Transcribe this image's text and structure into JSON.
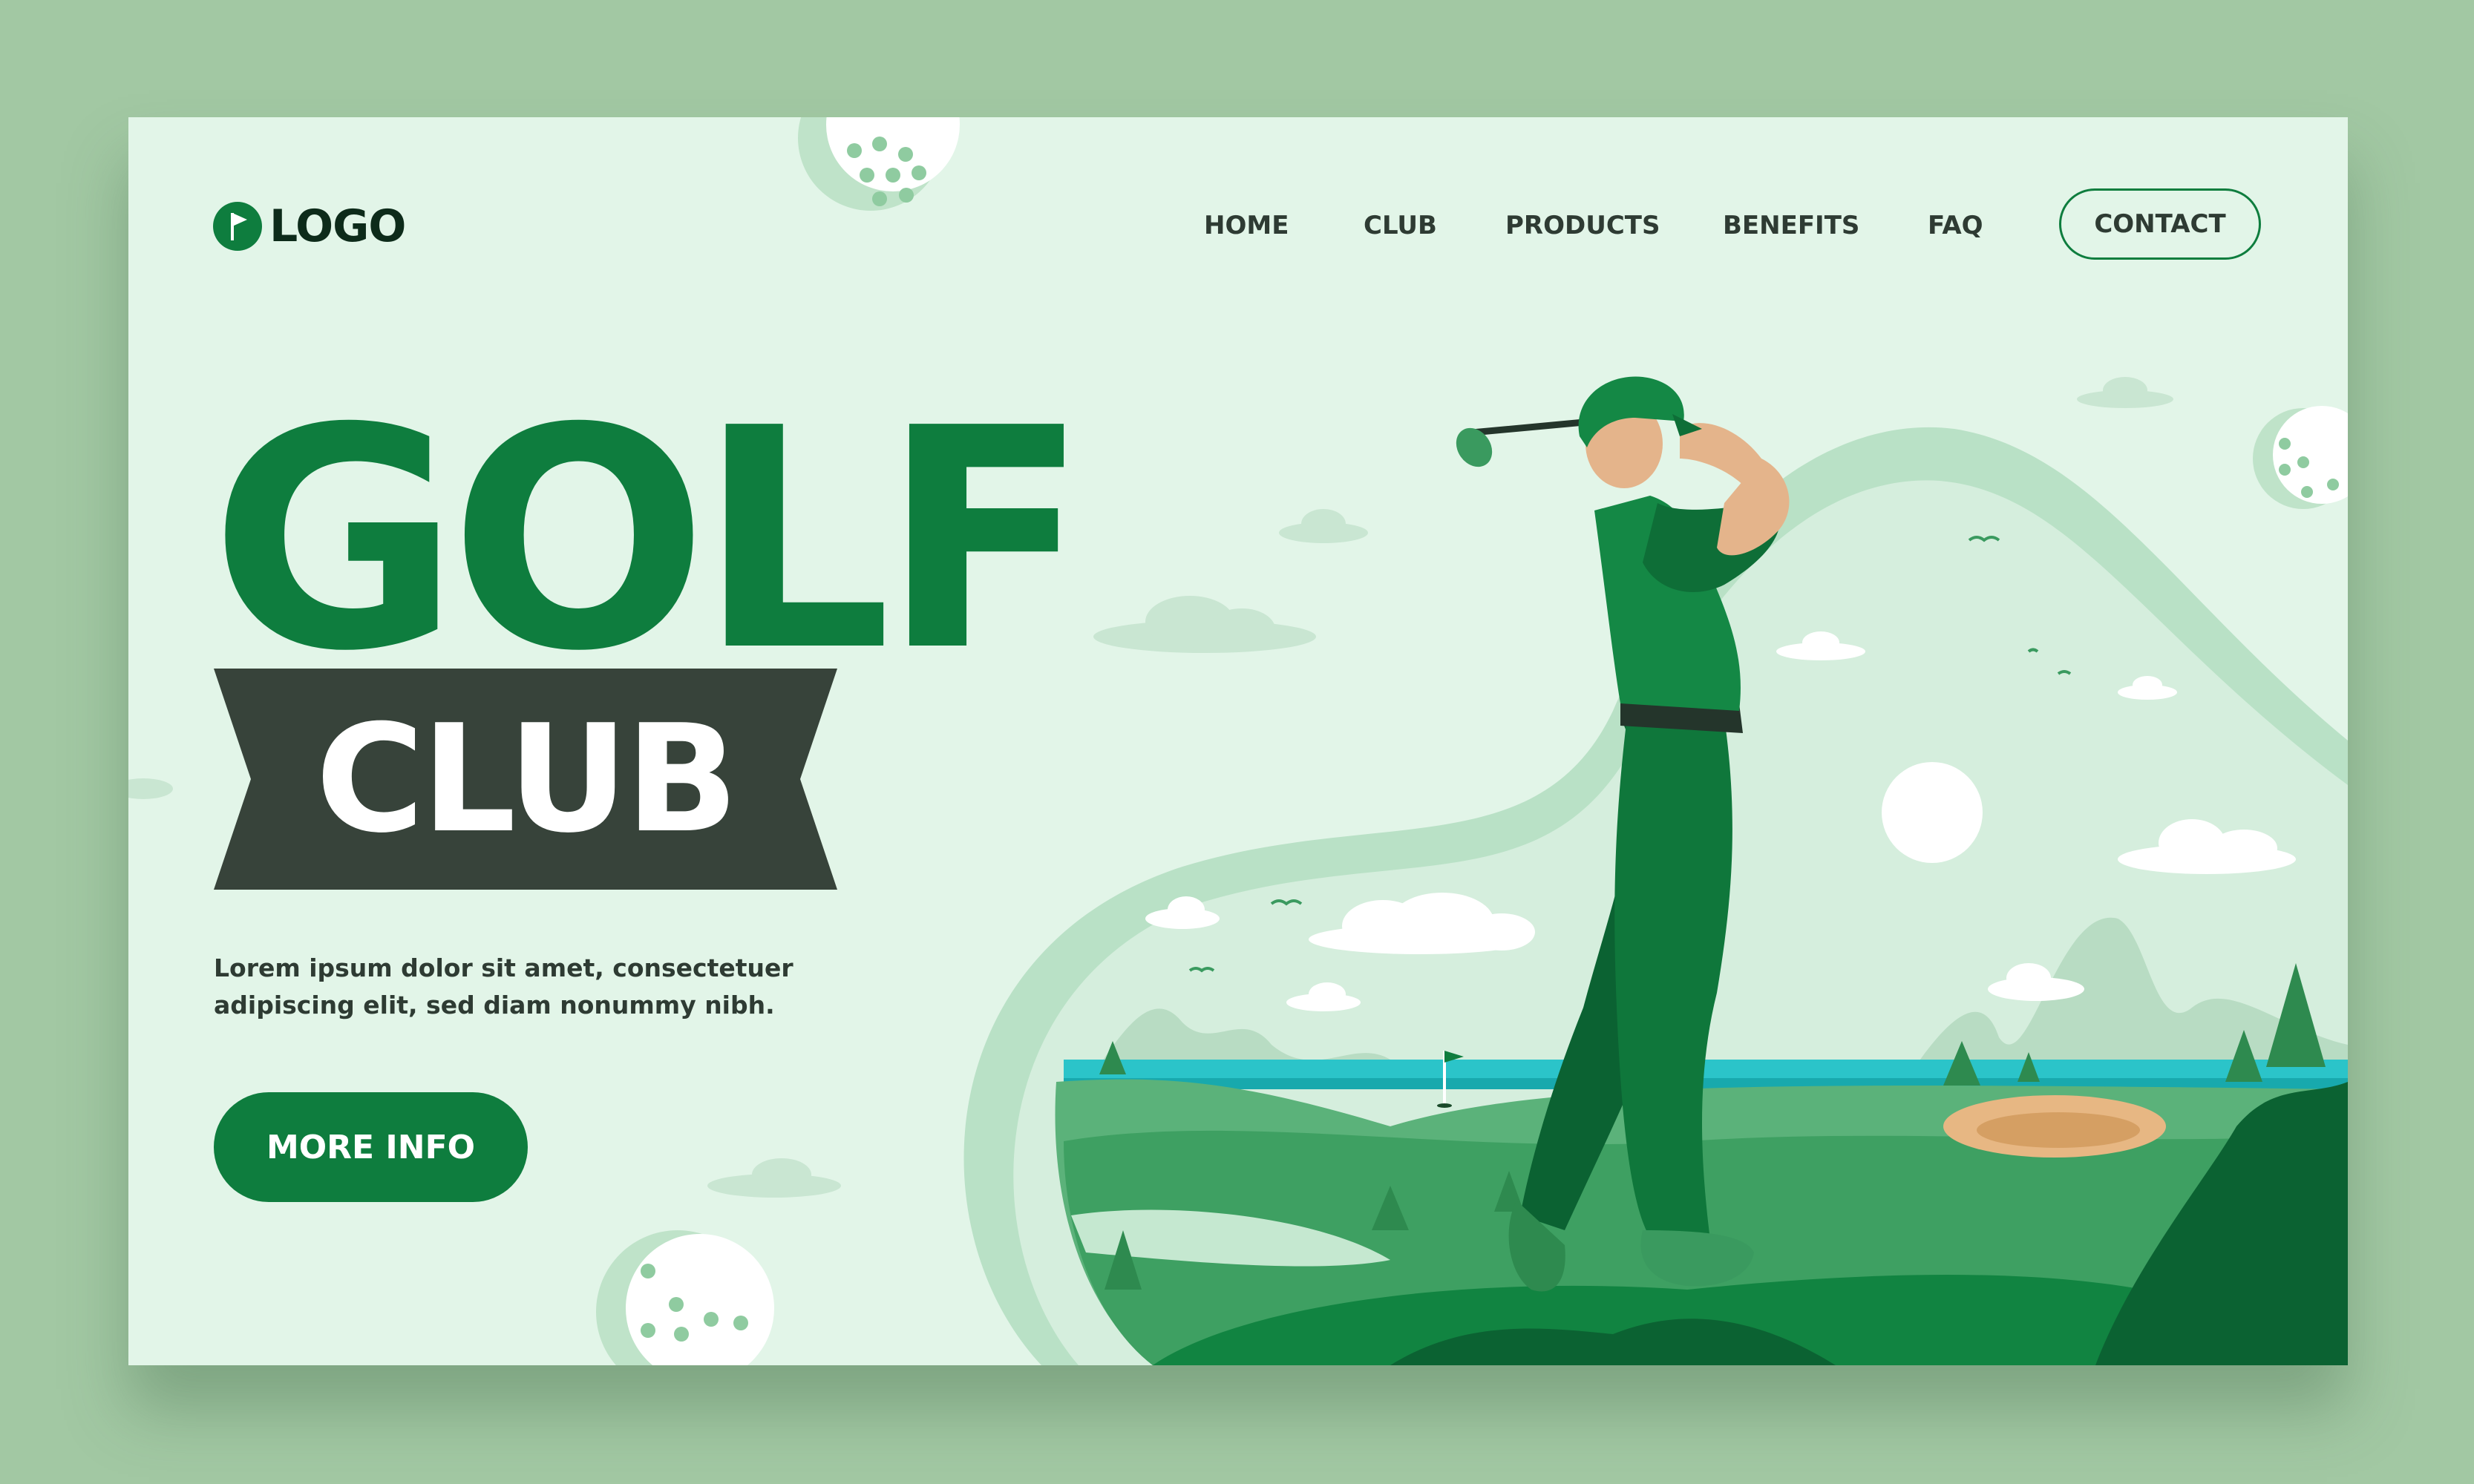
{
  "nav": {
    "logo_text": "LOGO",
    "items": [
      {
        "label": "HOME"
      },
      {
        "label": "CLUB"
      },
      {
        "label": "PRODUCTS"
      },
      {
        "label": "BENEFITS"
      },
      {
        "label": "FAQ"
      }
    ],
    "contact_label": "CONTACT"
  },
  "hero": {
    "title": "GOLF",
    "subtitle": "CLUB",
    "description": "Lorem ipsum dolor sit amet, consectetuer adipiscing elit, sed diam nonummy nibh.",
    "cta_label": "MORE INFO"
  },
  "icons": {
    "logo": "golf-flag-icon",
    "illustration": "golfer-illustration"
  },
  "colors": {
    "outer_background": "#a2c8a3",
    "page_background": "#e2f5e8",
    "primary_green": "#0e7d3e",
    "banner_dark": "#37433a",
    "text_dark": "#2e3b33"
  }
}
